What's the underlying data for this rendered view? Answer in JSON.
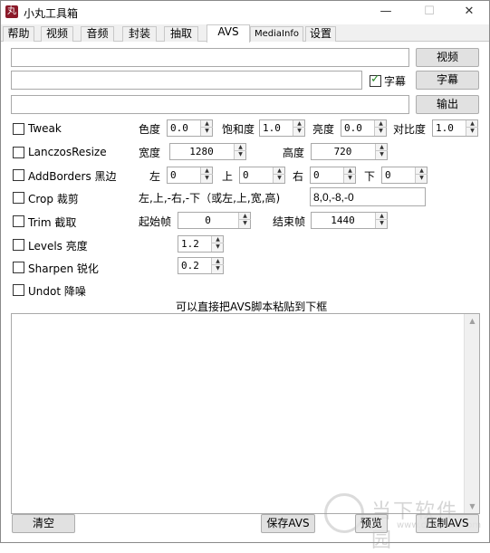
{
  "window": {
    "title": "小丸工具箱",
    "app_icon_glyph": "丸",
    "minimize_glyph": "—",
    "maximize_glyph": "☐",
    "close_glyph": "✕"
  },
  "tabs": [
    "帮助",
    "视频",
    "音频",
    "封装",
    "抽取",
    "AVS",
    "MediaInfo",
    "设置"
  ],
  "active_tab": "AVS",
  "inputs": {
    "video_path": "",
    "subtitle_path": "",
    "output_path": ""
  },
  "buttons": {
    "video": "视频",
    "subtitle": "字幕",
    "output": "输出",
    "clear": "清空",
    "save_avs": "保存AVS",
    "preview": "预览",
    "compress_avs": "压制AVS"
  },
  "subtitle_checkbox": {
    "label": "字幕",
    "checked": true
  },
  "filters": {
    "tweak": {
      "label": "Tweak",
      "checked": false,
      "hue_label": "色度",
      "hue": "0.0",
      "sat_label": "饱和度",
      "sat": "1.0",
      "bright_label": "亮度",
      "bright": "0.0",
      "cont_label": "对比度",
      "cont": "1.0"
    },
    "lanczos": {
      "label": "LanczosResize",
      "checked": false,
      "width_label": "宽度",
      "width": "1280",
      "height_label": "高度",
      "height": "720"
    },
    "addborders": {
      "label": "AddBorders 黑边",
      "checked": false,
      "left_label": "左",
      "left": "0",
      "top_label": "上",
      "top": "0",
      "right_label": "右",
      "right": "0",
      "bottom_label": "下",
      "bottom": "0"
    },
    "crop": {
      "label": "Crop 裁剪",
      "checked": false,
      "hint": "左,上,-右,-下（或左,上,宽,高)",
      "value": "8,0,-8,-0"
    },
    "trim": {
      "label": "Trim 截取",
      "checked": false,
      "start_label": "起始帧",
      "start": "0",
      "end_label": "结束帧",
      "end": "1440"
    },
    "levels": {
      "label": "Levels 亮度",
      "checked": false,
      "value": "1.2"
    },
    "sharpen": {
      "label": "Sharpen 锐化",
      "checked": false,
      "value": "0.2"
    },
    "undot": {
      "label": "Undot 降噪",
      "checked": false
    }
  },
  "script_hint": "可以直接把AVS脚本粘贴到下框",
  "script_text": "",
  "watermark": {
    "text": "当下软件园",
    "url": "www.downxia.com"
  },
  "colors": {
    "window_bg": "#f0f0f0",
    "content_bg": "#ffffff",
    "icon_red": "#8b1a2a",
    "check_green": "#2a8a2a"
  }
}
